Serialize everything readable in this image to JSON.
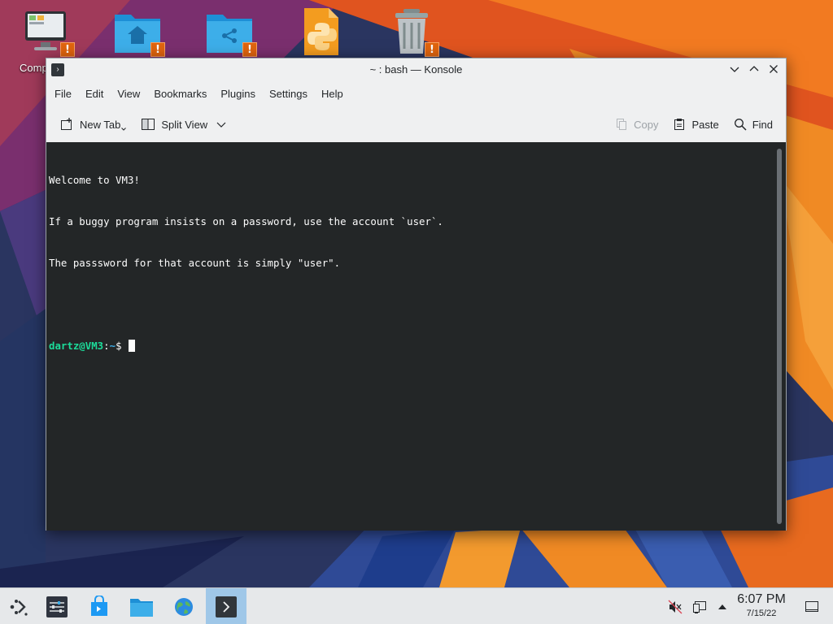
{
  "desktop": {
    "icons": [
      {
        "name": "computer",
        "label": "Comp"
      },
      {
        "name": "home-folder"
      },
      {
        "name": "shared-folder"
      },
      {
        "name": "python-file"
      },
      {
        "name": "trash"
      }
    ],
    "emblem_symbol": "!"
  },
  "window": {
    "title": "~ : bash — Konsole",
    "app_icon_glyph": "›",
    "menu": [
      "File",
      "Edit",
      "View",
      "Bookmarks",
      "Plugins",
      "Settings",
      "Help"
    ],
    "toolbar": {
      "new_tab": "New Tab",
      "split_view": "Split View",
      "copy": "Copy",
      "paste": "Paste",
      "find": "Find"
    },
    "terminal": {
      "lines": [
        "Welcome to VM3!",
        "If a buggy program insists on a password, use the account `user`.",
        "The passsword for that account is simply \"user\"."
      ],
      "prompt_user": "dartz@VM3",
      "prompt_sep": ":",
      "prompt_path": "~",
      "prompt_symbol": "$"
    }
  },
  "taskbar": {
    "items": [
      "application-launcher",
      "system-settings",
      "discover",
      "dolphin",
      "web-browser",
      "konsole"
    ],
    "active_item": "konsole",
    "clock": {
      "time": "6:07 PM",
      "date": "7/15/22"
    }
  },
  "colors": {
    "terminal_bg": "#232627",
    "prompt_user": "#1cdc9a",
    "prompt_path": "#3daee9",
    "window_bg": "#eff0f1",
    "taskbar_bg": "#e6e8ea",
    "active_task": "#9fc7e8",
    "emblem": "#e0640e"
  }
}
